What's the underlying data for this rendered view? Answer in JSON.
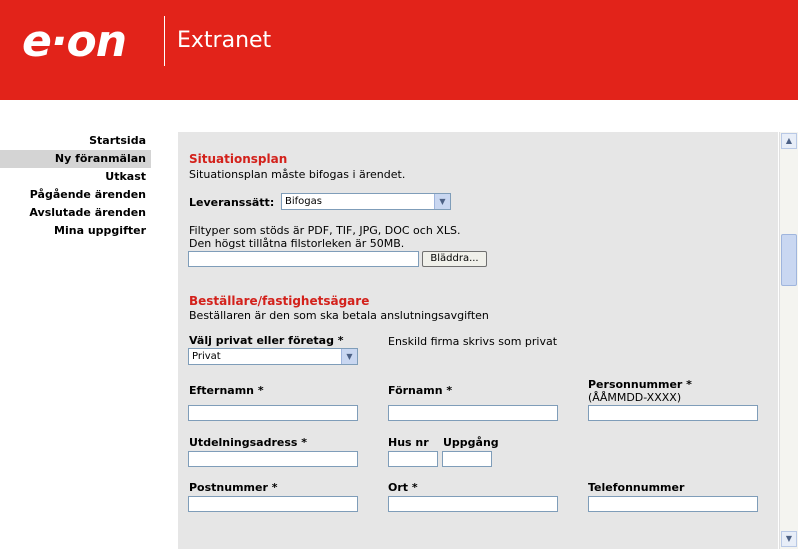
{
  "header": {
    "logo": "e·on",
    "title": "Extranet"
  },
  "sidebar": {
    "items": [
      {
        "label": "Startsida"
      },
      {
        "label": "Ny föranmälan"
      },
      {
        "label": "Utkast"
      },
      {
        "label": "Pågående ärenden"
      },
      {
        "label": "Avslutade ärenden"
      },
      {
        "label": "Mina uppgifter"
      }
    ]
  },
  "situationsplan": {
    "title": "Situationsplan",
    "description": "Situationsplan måste bifogas i ärendet.",
    "delivery_label": "Leveranssätt:",
    "delivery_value": "Bifogas",
    "filetypes_text": "Filtyper som stöds är PDF, TIF, JPG, DOC och XLS.",
    "maxsize_text": "Den högst tillåtna filstorleken är 50MB.",
    "file_value": "",
    "browse_label": "Bläddra..."
  },
  "bestallare": {
    "title": "Beställare/fastighetsägare",
    "description": "Beställaren är den som ska betala anslutningsavgiften",
    "type_label": "Välj privat eller företag *",
    "type_value": "Privat",
    "type_note": "Enskild firma skrivs som privat",
    "efternamn_label": "Efternamn *",
    "fornamn_label": "Förnamn *",
    "personnummer_label": "Personnummer *",
    "personnummer_hint": "(ÅÅMMDD-XXXX)",
    "utdelningsadress_label": "Utdelningsadress *",
    "husnr_label": "Hus nr",
    "uppgang_label": "Uppgång",
    "postnummer_label": "Postnummer *",
    "ort_label": "Ort *",
    "telefonnummer_label": "Telefonnummer"
  },
  "scrollbar": {
    "up_icon": "arrow-up-icon",
    "down_icon": "arrow-down-icon"
  },
  "colors": {
    "brand": "#e2231a",
    "section_title": "#d3211b",
    "content_bg": "#e6e6e6"
  }
}
